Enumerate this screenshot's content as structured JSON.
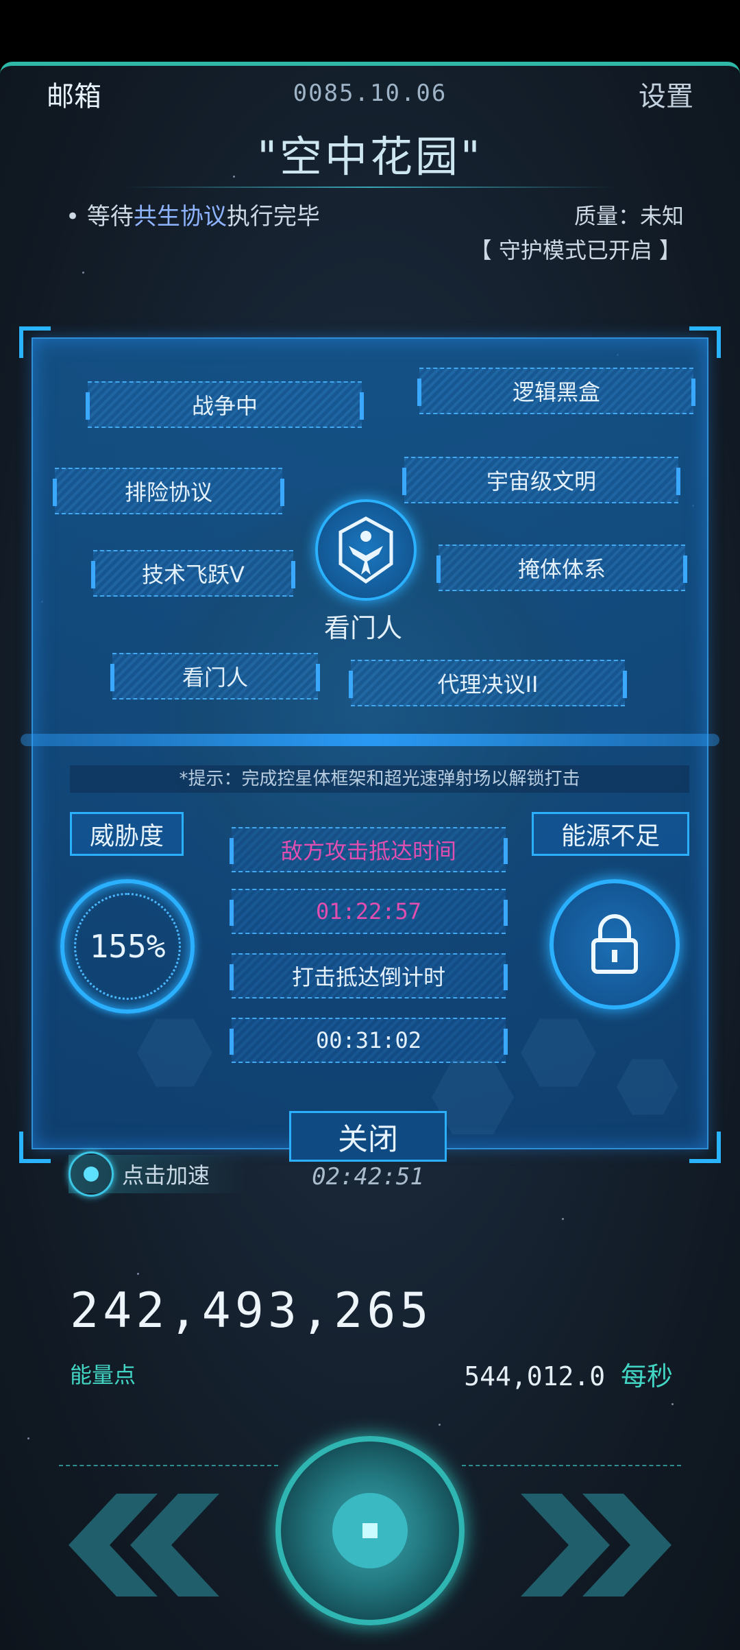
{
  "header": {
    "mail": "邮箱",
    "date": "0085.10.06",
    "settings": "设置"
  },
  "title": "\"空中花园\"",
  "status": {
    "prefix": "• 等待",
    "highlight": "共生协议",
    "suffix": "执行完毕",
    "quality": "质量：未知",
    "guard": "【 守护模式已开启 】"
  },
  "panel": {
    "nodes": [
      "战争中",
      "逻辑黑盒",
      "排险协议",
      "宇宙级文明",
      "技术飞跃V",
      "掩体体系",
      "看门人",
      "代理决议II"
    ],
    "emblem_label": "看门人",
    "hint": "*提示：完成控星体框架和超光速弹射场以解锁打击",
    "threat_label": "威胁度",
    "threat_value": "155%",
    "energy_status": "能源不足",
    "enemy_label": "敌方攻击抵达时间",
    "enemy_time": "01:22:57",
    "strike_label": "打击抵达倒计时",
    "strike_time": "00:31:02",
    "close_label": "关闭",
    "close_time": "02:42:51",
    "speed_label": "点击加速"
  },
  "resources": {
    "energy_points": "242,493,265",
    "energy_label": "能量点",
    "rate_value": "544,012.0",
    "rate_unit": "每秒"
  },
  "colors": {
    "accent": "#2bb0ff",
    "teal": "#43d5c4",
    "enemy_time": "#e04fb0"
  }
}
